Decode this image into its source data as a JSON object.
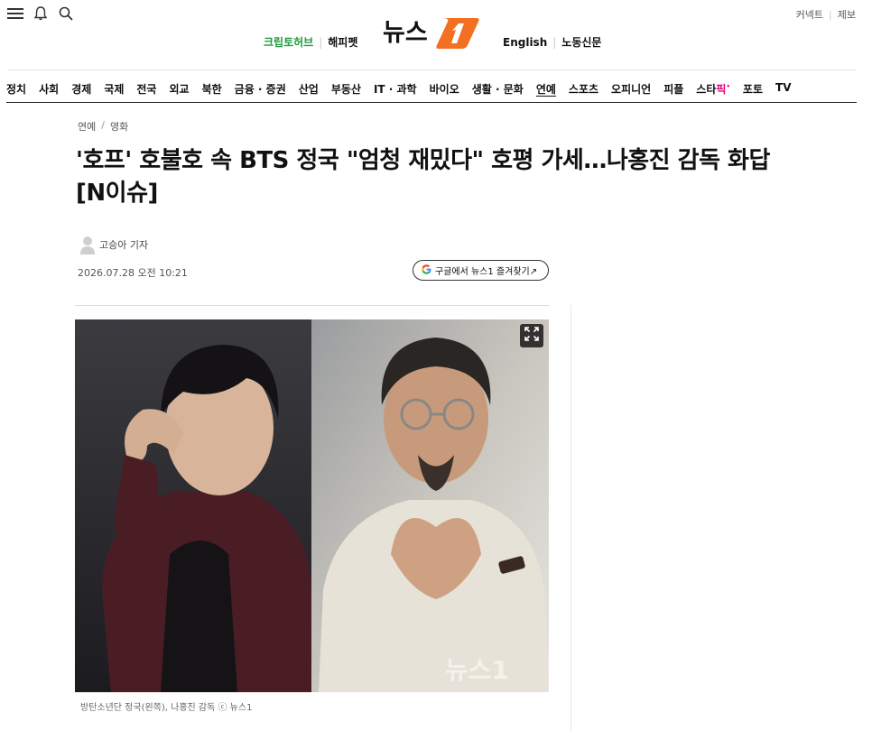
{
  "header": {
    "top_links": [
      "커넥트",
      "제보"
    ],
    "partners_left": [
      "크립토허브",
      "해피펫"
    ],
    "partners_right": [
      "English",
      "노동신문"
    ],
    "logo_text": "뉴스1"
  },
  "nav": {
    "items": [
      "정치",
      "사회",
      "경제",
      "국제",
      "전국",
      "외교",
      "북한",
      "금융 · 증권",
      "산업",
      "부동산",
      "IT · 과학",
      "바이오",
      "생활 · 문화",
      "연예",
      "스포츠",
      "오피니언",
      "피플"
    ],
    "active": "연예",
    "star_pick_prefix": "스타",
    "star_pick_suffix": "픽",
    "tail": [
      "포토",
      "TV"
    ]
  },
  "article": {
    "breadcrumb": [
      "연예",
      "영화"
    ],
    "title": "'호프' 호불호 속 BTS 정국 \"엄청 재밌다\" 호평 가세…나홍진 감독 화답 [N이슈]",
    "author": "고승아 기자",
    "date": "2026.07.28 오전 10:21",
    "google_follow": "구글에서 뉴스1 즐겨찾기↗",
    "caption": "방탄소년단 정국(왼쪽), 나홍진 감독 ⓒ 뉴스1",
    "watermark": "뉴스1"
  },
  "colors": {
    "brand_orange": "#f36f21",
    "crypto_green": "#1e9b3b",
    "star_pink": "#e6007e"
  },
  "icons": [
    "menu-icon",
    "bell-icon",
    "search-icon",
    "person-avatar-icon",
    "google-g-icon",
    "expand-icon"
  ]
}
